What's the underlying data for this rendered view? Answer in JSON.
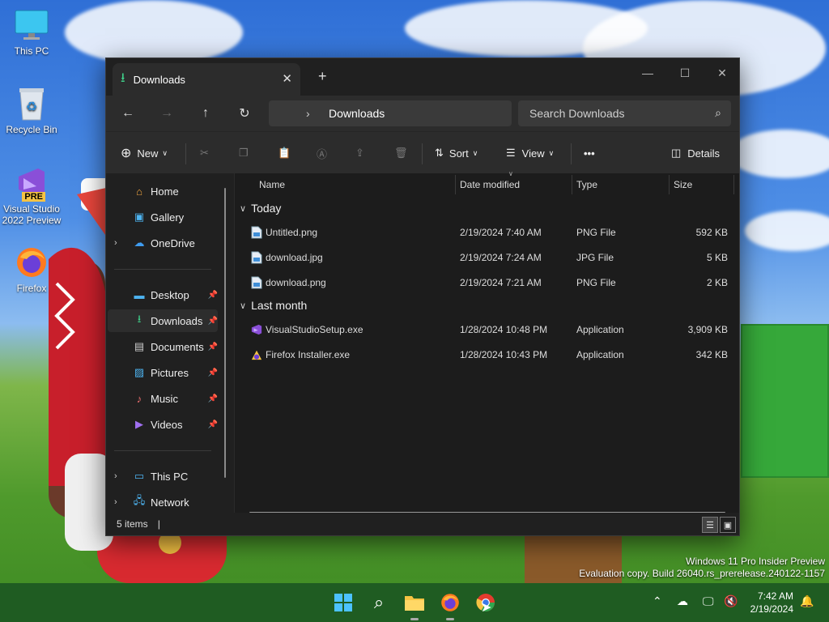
{
  "desktop": {
    "icons": [
      {
        "label": "This PC"
      },
      {
        "label": "Recycle Bin"
      },
      {
        "label": "Visual Studio 2022 Preview",
        "badge": "PRE"
      },
      {
        "label": "Firefox"
      }
    ]
  },
  "window": {
    "tab_title": "Downloads",
    "new_tab": "+",
    "controls": {
      "minimize": "—",
      "maximize": "☐",
      "close": "✕"
    },
    "address": "Downloads",
    "search_placeholder": "Search Downloads",
    "toolbar": {
      "new_label": "New",
      "sort_label": "Sort",
      "view_label": "View",
      "more_label": "•••",
      "details_label": "Details"
    },
    "sidebar": {
      "top": [
        {
          "label": "Home",
          "icon": "home-icon"
        },
        {
          "label": "Gallery",
          "icon": "gallery-icon"
        },
        {
          "label": "OneDrive",
          "icon": "onedrive-icon"
        }
      ],
      "quick": [
        {
          "label": "Desktop",
          "icon": "desktop-folder-icon"
        },
        {
          "label": "Downloads",
          "icon": "downloads-folder-icon"
        },
        {
          "label": "Documents",
          "icon": "documents-folder-icon"
        },
        {
          "label": "Pictures",
          "icon": "pictures-folder-icon"
        },
        {
          "label": "Music",
          "icon": "music-folder-icon"
        },
        {
          "label": "Videos",
          "icon": "videos-folder-icon"
        }
      ],
      "bottom": [
        {
          "label": "This PC",
          "icon": "this-pc-icon"
        },
        {
          "label": "Network",
          "icon": "network-icon"
        }
      ]
    },
    "columns": {
      "name": "Name",
      "date": "Date modified",
      "type": "Type",
      "size": "Size"
    },
    "groups": [
      {
        "label": "Today",
        "files": [
          {
            "name": "Untitled.png",
            "date": "2/19/2024 7:40 AM",
            "type": "PNG File",
            "size": "592 KB",
            "icon": "png-file-icon"
          },
          {
            "name": "download.jpg",
            "date": "2/19/2024 7:24 AM",
            "type": "JPG File",
            "size": "5 KB",
            "icon": "jpg-file-icon"
          },
          {
            "name": "download.png",
            "date": "2/19/2024 7:21 AM",
            "type": "PNG File",
            "size": "2 KB",
            "icon": "png-file-icon"
          }
        ]
      },
      {
        "label": "Last month",
        "files": [
          {
            "name": "VisualStudioSetup.exe",
            "date": "1/28/2024 10:48 PM",
            "type": "Application",
            "size": "3,909 KB",
            "icon": "visual-studio-icon"
          },
          {
            "name": "Firefox Installer.exe",
            "date": "1/28/2024 10:43 PM",
            "type": "Application",
            "size": "342 KB",
            "icon": "firefox-installer-icon"
          }
        ]
      }
    ],
    "status": "5 items"
  },
  "watermark": {
    "line1": "Windows 11 Pro Insider Preview",
    "line2": "Evaluation copy. Build 26040.rs_prerelease.240122-1157"
  },
  "taskbar": {
    "time": "7:42 AM",
    "date": "2/19/2024"
  }
}
